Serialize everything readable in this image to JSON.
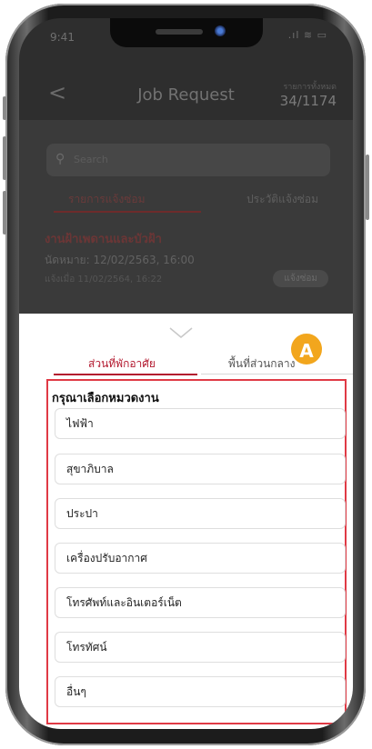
{
  "status": {
    "time": "9:41",
    "icons": ".ıl ≋ ▭"
  },
  "header": {
    "back": "<",
    "title": "Job Request",
    "count_label": "รายการทั้งหมด",
    "count": "34/1174"
  },
  "search": {
    "placeholder": "Search"
  },
  "bg_tabs": [
    "รายการแจ้งซ่อม",
    "ประวัติแจ้งซ่อม"
  ],
  "cards": [
    {
      "title": "งานฝ้าเพดานและบัวฝ้า",
      "appointment": "นัดหมาย: 12/02/2563, 16:00",
      "reported": "แจ้งเมื่อ 11/02/2564, 16:22",
      "badge": "แจ้งซ่อม"
    }
  ],
  "sheet": {
    "tabs": [
      "ส่วนที่พักอาศัย",
      "พื้นที่ส่วนกลาง"
    ],
    "marker": "A",
    "section_title": "กรุณาเลือกหมวดงาน",
    "options": [
      "ไฟฟ้า",
      "สุขาภิบาล",
      "ประปา",
      "เครื่องปรับอากาศ",
      "โทรศัพท์และอินเตอร์เน็ต",
      "โทรทัศน์",
      "อื่นๆ"
    ]
  },
  "colors": {
    "accent": "#b3192f",
    "marker": "#f2a61d",
    "outline": "#e03a45"
  }
}
